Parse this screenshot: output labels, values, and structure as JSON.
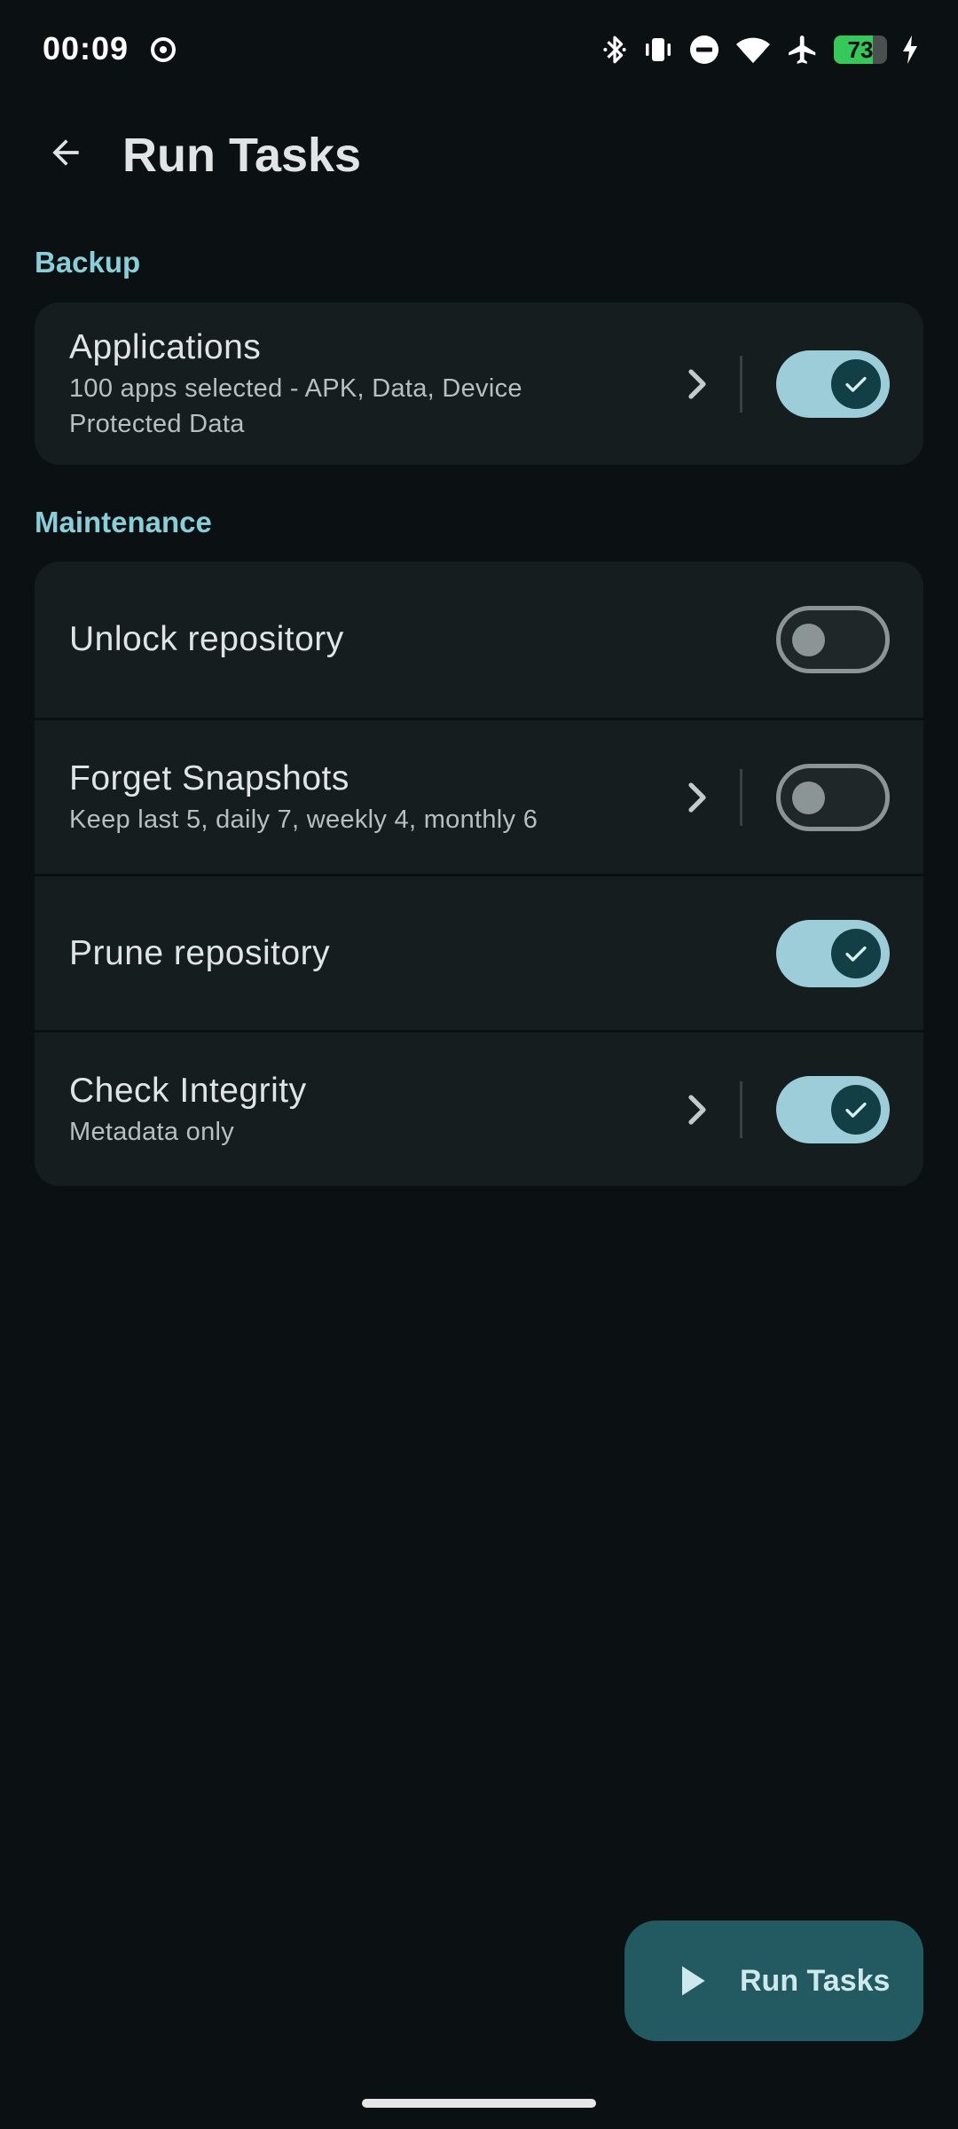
{
  "status_bar": {
    "time": "00:09",
    "battery_level": "73",
    "battery_fraction": 0.73,
    "icons": [
      "recording-icon",
      "bluetooth-icon",
      "vibrate-icon",
      "do-not-disturb-icon",
      "wifi-icon",
      "airplane-mode-icon",
      "battery-icon",
      "charging-icon"
    ]
  },
  "app_bar": {
    "title": "Run Tasks",
    "back_icon": "arrow-left-icon"
  },
  "sections": {
    "backup": {
      "label": "Backup",
      "items": [
        {
          "title": "Applications",
          "subtitle": "100 apps selected - APK, Data, Device Protected Data",
          "has_details": true,
          "enabled": true
        }
      ]
    },
    "maintenance": {
      "label": "Maintenance",
      "items": [
        {
          "title": "Unlock repository",
          "subtitle": "",
          "has_details": false,
          "enabled": false
        },
        {
          "title": "Forget Snapshots",
          "subtitle": "Keep last 5, daily 7, weekly 4, monthly 6",
          "has_details": true,
          "enabled": false
        },
        {
          "title": "Prune repository",
          "subtitle": "",
          "has_details": false,
          "enabled": true
        },
        {
          "title": "Check Integrity",
          "subtitle": "Metadata only",
          "has_details": true,
          "enabled": true
        }
      ]
    }
  },
  "fab": {
    "label": "Run Tasks",
    "icon": "play-icon"
  },
  "colors": {
    "background": "#0b1112",
    "card": "#161d1f",
    "accent": "#89cfd9",
    "switch_on_track": "#9dcdd8",
    "switch_on_thumb": "#123f46",
    "fab": "#235a62"
  }
}
